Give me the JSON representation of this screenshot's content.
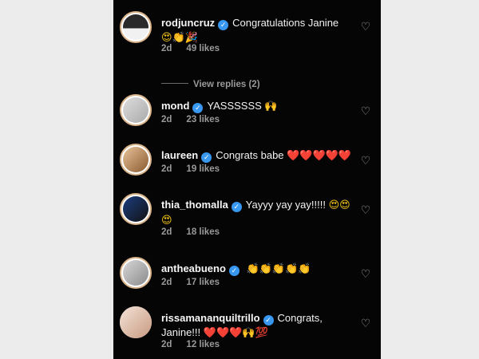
{
  "comments": [
    {
      "username": "rodjuncruz",
      "text": "Congratulations Janine",
      "emoji": "😍👏🎉",
      "time": "2d",
      "likes": "49 likes",
      "view_replies": "View replies (2)"
    },
    {
      "username": "mond",
      "text": "YASSSSSS",
      "emoji": "🙌",
      "time": "2d",
      "likes": "23 likes"
    },
    {
      "username": "laureen",
      "text": "Congrats babe",
      "emoji": "❤️❤️❤️❤️❤️",
      "time": "2d",
      "likes": "19 likes"
    },
    {
      "username": "thia_thomalla",
      "text": "Yayyy yay yay!!!!!",
      "emoji": "😍😍😍",
      "time": "2d",
      "likes": "18 likes"
    },
    {
      "username": "antheabueno",
      "text": "",
      "emoji": "👏👏👏👏👏",
      "time": "2d",
      "likes": "17 likes"
    },
    {
      "username": "rissamananquiltrillo",
      "text": "Congrats, Janine!!!",
      "emoji": "❤️❤️❤️🙌💯",
      "time": "2d",
      "likes": "12 likes"
    }
  ],
  "icons": {
    "verified": "verified-badge-icon",
    "like": "heart-icon"
  },
  "colors": {
    "background": "#050505",
    "verified": "#3897f0",
    "muted": "#9a9a9a",
    "heart_emoji": "#e8283c"
  }
}
